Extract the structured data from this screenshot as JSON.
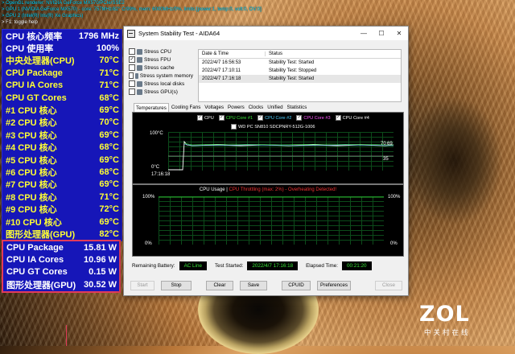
{
  "osd_header": {
    "lines": [
      "> OpenGL renderer: NVIDIA GeForce MX570/PCIe/SSE2",
      "> GPU 1 (NVIDIA GeForce MX570) - core: 757MHz/82° C/99%, mem: 6000MHz/0%, limits:[power:1, temp:0, volt:0, OV:0]",
      "> GPU 2 (Intel(R) Iris(R) Xe Graphics)",
      "> F1: toggle help"
    ]
  },
  "osd_stats": [
    {
      "label": "CPU 核心频率",
      "value": "1796 MHz"
    },
    {
      "label": "CPU 使用率",
      "value": "100%"
    },
    {
      "label": "中央处理器(CPU)",
      "value": "70°C"
    },
    {
      "label": "CPU Package",
      "value": "71°C"
    },
    {
      "label": "CPU IA Cores",
      "value": "71°C"
    },
    {
      "label": "CPU GT Cores",
      "value": "68°C"
    },
    {
      "label": "#1 CPU 核心",
      "value": "69°C"
    },
    {
      "label": "#2 CPU 核心",
      "value": "70°C"
    },
    {
      "label": "#3 CPU 核心",
      "value": "69°C"
    },
    {
      "label": "#4 CPU 核心",
      "value": "68°C"
    },
    {
      "label": "#5 CPU 核心",
      "value": "69°C"
    },
    {
      "label": "#6 CPU 核心",
      "value": "68°C"
    },
    {
      "label": "#7 CPU 核心",
      "value": "69°C"
    },
    {
      "label": "#8 CPU 核心",
      "value": "71°C"
    },
    {
      "label": "#9 CPU 核心",
      "value": "72°C"
    },
    {
      "label": "#10 CPU 核心",
      "value": "69°C"
    },
    {
      "label": "图形处理器(GPU)",
      "value": "82°C"
    }
  ],
  "osd_power": [
    {
      "label": "CPU Package",
      "value": "15.81 W"
    },
    {
      "label": "CPU IA Cores",
      "value": "10.96 W"
    },
    {
      "label": "CPU GT Cores",
      "value": "0.15 W"
    },
    {
      "label": "图形处理器(GPU)",
      "value": "30.52 W"
    }
  ],
  "window": {
    "title": "System Stability Test - AIDA64",
    "controls": {
      "minimize": "—",
      "maximize": "☐",
      "close": "✕"
    },
    "stress_items": [
      {
        "label": "Stress CPU",
        "checked": false
      },
      {
        "label": "Stress FPU",
        "checked": true
      },
      {
        "label": "Stress cache",
        "checked": false
      },
      {
        "label": "Stress system memory",
        "checked": false
      },
      {
        "label": "Stress local disks",
        "checked": false
      },
      {
        "label": "Stress GPU(s)",
        "checked": false
      }
    ],
    "log": {
      "headers": [
        "Date & Time",
        "Status"
      ],
      "rows": [
        [
          "2022/4/7 16:56:53",
          "Stability Test: Started"
        ],
        [
          "2022/4/7 17:10:11",
          "Stability Test: Stopped"
        ],
        [
          "2022/4/7 17:16:18",
          "Stability Test: Started"
        ]
      ]
    },
    "tabs": [
      "Temperatures",
      "Cooling Fans",
      "Voltages",
      "Powers",
      "Clocks",
      "Unified",
      "Statistics"
    ],
    "active_tab": "Temperatures",
    "temp_graph": {
      "legend": [
        "CPU",
        "CPU Core #1",
        "CPU Core #2",
        "CPU Core #3",
        "CPU Core #4"
      ],
      "legend_colors": [
        "#ffffff",
        "#39e639",
        "#4dd0ff",
        "#ff55ff",
        "#ffffff"
      ],
      "legend2": "WD PC SN810 SDCPNRY-512G-1006",
      "y_top": "100°C",
      "y_bottom": "0°C",
      "time": "17:16:18",
      "right_1": "70",
      "right_2": "69",
      "right_3": "35"
    },
    "usage_graph": {
      "title_a": "CPU Usage",
      "title_sep": "|",
      "title_b": "CPU Throttling (max: 2%) - Overheating Detected!",
      "y_top": "100%",
      "y_bottom": "0%"
    },
    "status": {
      "battery_label": "Remaining Battery:",
      "battery_value": "AC Line",
      "started_label": "Test Started:",
      "started_value": "2022/4/7 17:16:18",
      "elapsed_label": "Elapsed Time:",
      "elapsed_value": "00:21:20"
    },
    "buttons": [
      "Start",
      "Stop",
      "Clear",
      "Save",
      "CPUID",
      "Preferences",
      "Close"
    ]
  },
  "watermark": {
    "logo": "ZOL",
    "subtitle": "中关村在线"
  }
}
